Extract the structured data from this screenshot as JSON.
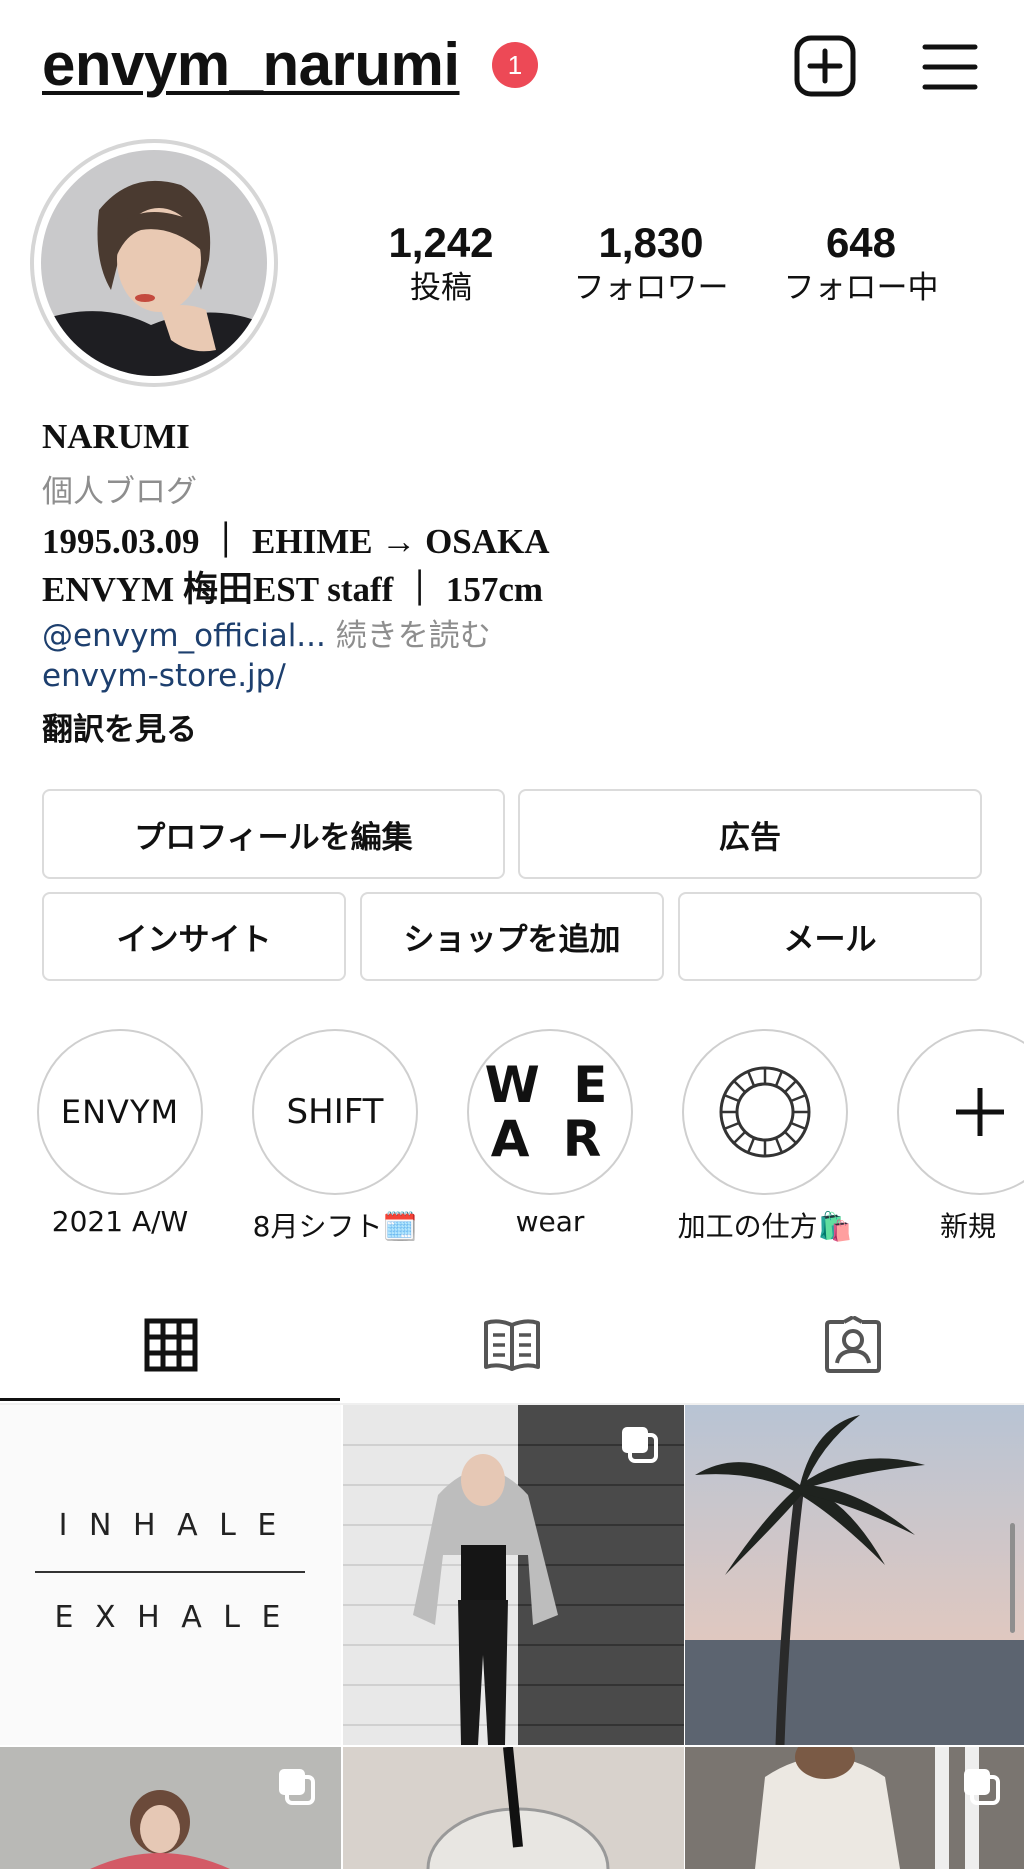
{
  "header": {
    "username": "envym_narumi",
    "notification_count": "1",
    "new_post_icon": "plus-square-icon",
    "menu_icon": "hamburger-menu-icon"
  },
  "stats": [
    {
      "value": "1,242",
      "label": "投稿"
    },
    {
      "value": "1,830",
      "label": "フォロワー"
    },
    {
      "value": "648",
      "label": "フォロー中"
    }
  ],
  "bio": {
    "name": "NARUMI",
    "category": "個人ブログ",
    "line1": "1995.03.09 ｜ EHIME → OSAKA",
    "line2": "ENVYM 梅田EST staff ｜ 157cm",
    "mention": "@envym_official...",
    "more": " 続きを読む",
    "url": "envym-store.jp/",
    "translate": "翻訳を見る"
  },
  "buttons": {
    "edit_profile": "プロフィールを編集",
    "ads": "広告",
    "insights": "インサイト",
    "add_shop": "ショップを追加",
    "email": "メール"
  },
  "highlights": [
    {
      "label": "2021 A/W",
      "cover_text": "ENVYM"
    },
    {
      "label": "8月シフト🗓️",
      "cover_text": "SHIFT"
    },
    {
      "label": "wear",
      "cover_text_top": "W E",
      "cover_text_bottom": "A R"
    },
    {
      "label": "加工の仕方🛍️",
      "cover_icon": "ring-filter-icon"
    },
    {
      "label": "新規",
      "cover_icon": "plus-icon"
    }
  ],
  "tabs": {
    "grid_icon": "grid-icon",
    "guide_icon": "guide-book-icon",
    "tagged_icon": "tagged-person-icon"
  },
  "posts": {
    "tile1_top": "I N H A L E",
    "tile1_bottom": "E X H A L E"
  },
  "colors": {
    "badge": "#ed4956",
    "link": "#1d3f6e",
    "muted": "#8e8e8e",
    "border": "#dbdbdb"
  }
}
